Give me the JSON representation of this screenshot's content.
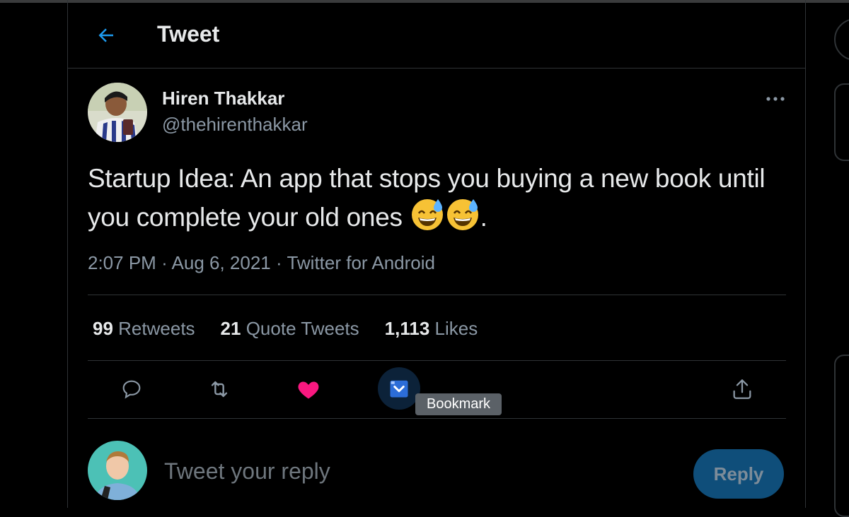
{
  "header": {
    "title": "Tweet",
    "back_icon": "arrow-left-icon"
  },
  "tweet": {
    "author": {
      "display_name": "Hiren Thakkar",
      "handle": "@thehirenthakkar"
    },
    "text": "Startup Idea: An app that stops you buying a new book until you complete your old ones ",
    "text_end": ".",
    "emoji_names": [
      "grinning-face-with-sweat-icon",
      "grinning-face-with-sweat-icon"
    ],
    "time": "2:07 PM",
    "date": "Aug 6, 2021",
    "source": "Twitter for Android",
    "separator": "·"
  },
  "stats": {
    "retweets": {
      "count": "99",
      "label": "Retweets"
    },
    "quotes": {
      "count": "21",
      "label": "Quote Tweets"
    },
    "likes": {
      "count": "1,113",
      "label": "Likes"
    }
  },
  "actions": {
    "reply_icon": "comment-icon",
    "retweet_icon": "retweet-icon",
    "like_icon": "heart-icon",
    "bookmark_icon": "bookmark-icon",
    "share_icon": "share-icon",
    "liked": true,
    "tooltip": "Bookmark"
  },
  "reply_box": {
    "placeholder": "Tweet your reply",
    "button_label": "Reply"
  },
  "colors": {
    "background": "#000000",
    "accent": "#1d9bf0",
    "like": "#f91880",
    "reply_button_bg": "#0f4e7a"
  }
}
